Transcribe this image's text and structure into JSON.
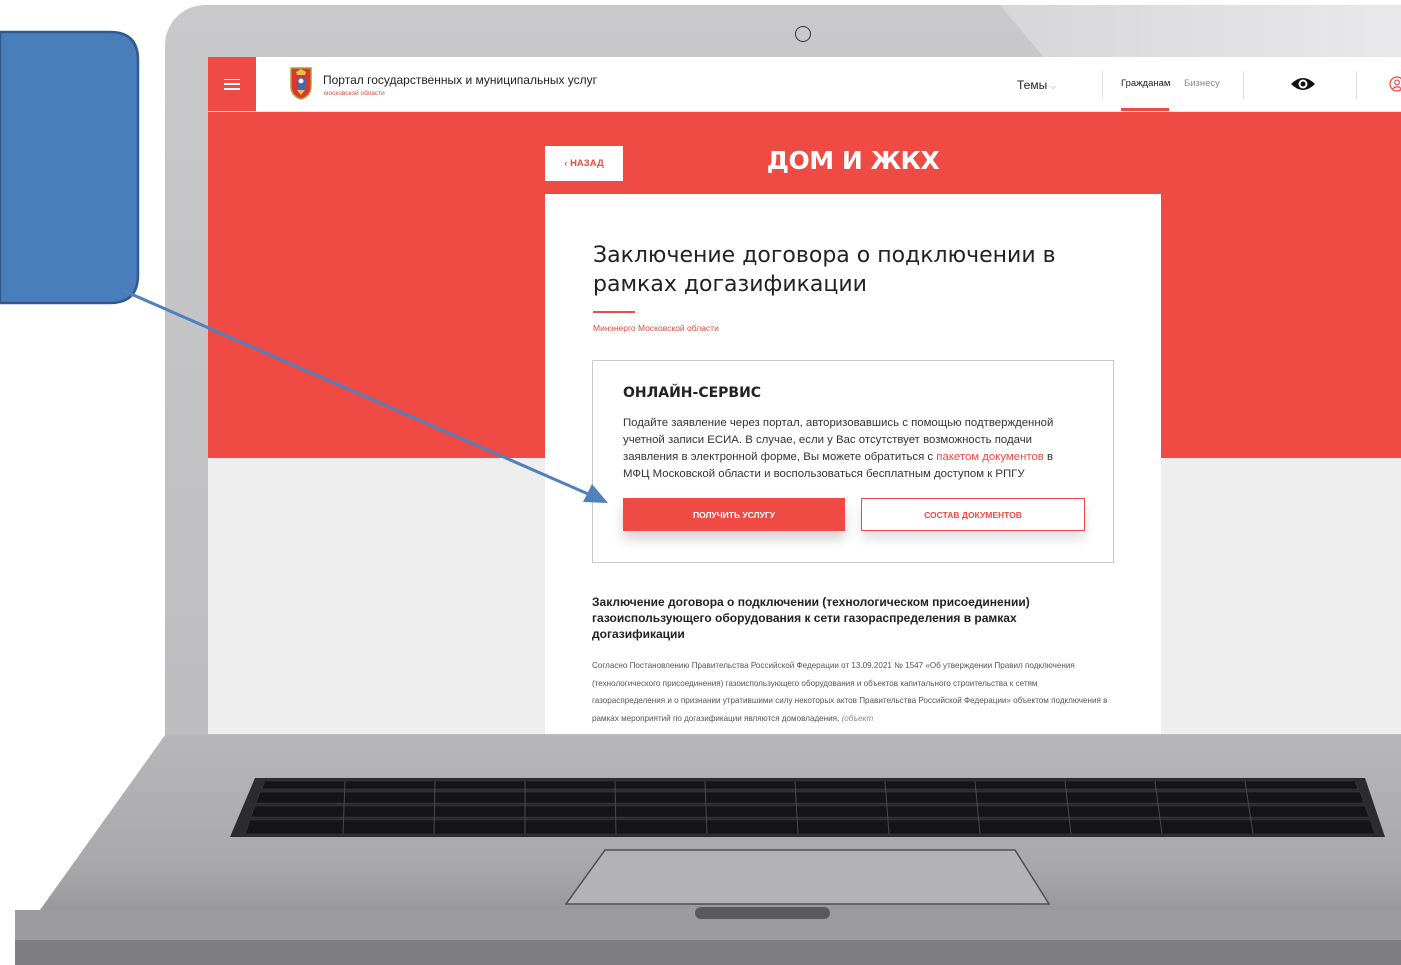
{
  "portal": {
    "title": "Портал государственных и муниципальных услуг",
    "subtitle": "московской области"
  },
  "nav": {
    "themes": "Темы",
    "themes_chevron": "⌵",
    "citizens": "Гражданам",
    "business": "Бизнесу"
  },
  "banner": {
    "back_label": "‹ НАЗАД",
    "section_title": "ДОМ И ЖКХ"
  },
  "service": {
    "title": "Заключение договора о подключении в рамках догазификации",
    "ministry": "Минэнерго Московской области"
  },
  "online_service": {
    "heading": "ОНЛАЙН-СЕРВИС",
    "text_before_link": "Подайте заявление через портал, авторизовавшись с помощью подтвержденной учетной записи ЕСИА. В случае, если у Вас отсутствует возможность подачи заявления в электронной форме, Вы можете обратиться с ",
    "link_text": "пакетом документов",
    "text_after_link": " в МФЦ Московской области и воспользоваться бесплатным доступом к РПГУ",
    "get_service_button": "ПОЛУЧИТЬ УСЛУГУ",
    "documents_button": "СОСТАВ ДОКУМЕНТОВ"
  },
  "description": {
    "heading": "Заключение договора о подключении (технологическом присоединении) газоиспользующего оборудования к сети газораспределения в рамках догазификации",
    "text": "Согласно Постановлению Правительства Российской Федерации от 13.09.2021 № 1547 «Об утверждении Правил подключения (технологического присоединения) газоиспользующего оборудования и объектов капитального строительства к сетям газораспределения и о признании утратившими силу некоторых актов Правительства Российской Федерации» объектом подключения в рамках мероприятий по догазификации являются домовладения, ",
    "text_italic": "(объект"
  },
  "colors": {
    "accent": "#ef4a44",
    "callout": "#4a7ebb",
    "arrow": "#4f81bd"
  }
}
